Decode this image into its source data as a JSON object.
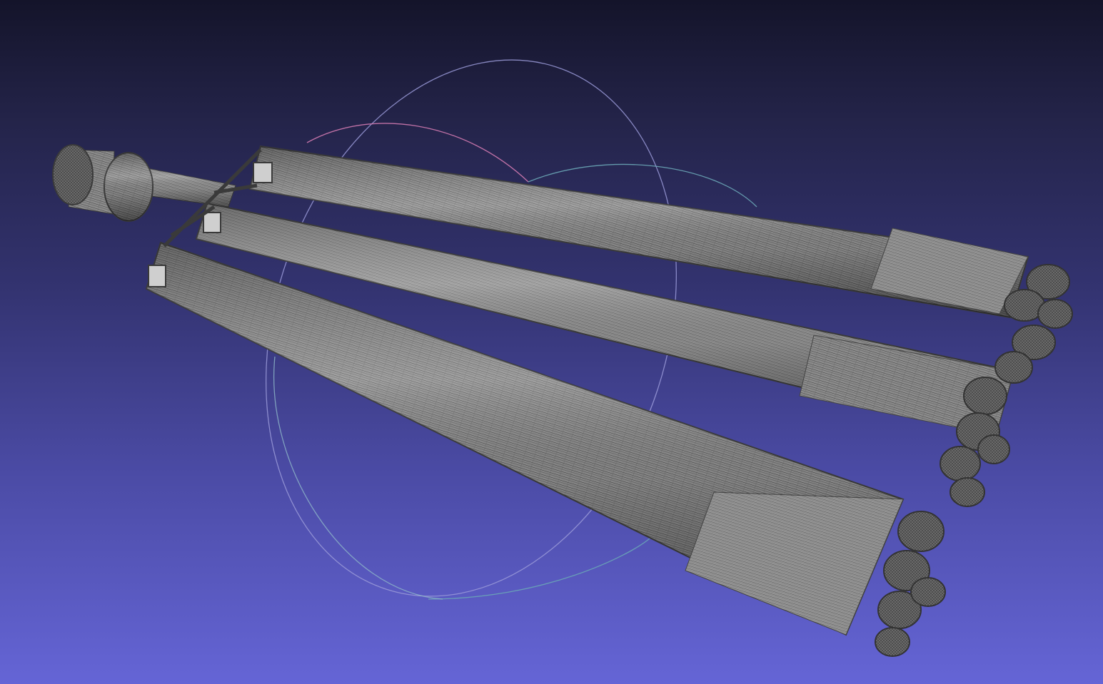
{
  "viewer": {
    "background_top": "#14142a",
    "background_bottom": "#6565d6",
    "mesh_fill": "#8f8f8f",
    "mesh_wire": "#3f3f3f",
    "mesh_highlight": "#c9c9c9"
  },
  "trackball": {
    "ring_colors": [
      "#9a9ad8",
      "#d27ab0",
      "#6aa6b6"
    ]
  },
  "model": {
    "shape": "heavy-launch-vehicle-wireframe",
    "booster_count": 3
  }
}
